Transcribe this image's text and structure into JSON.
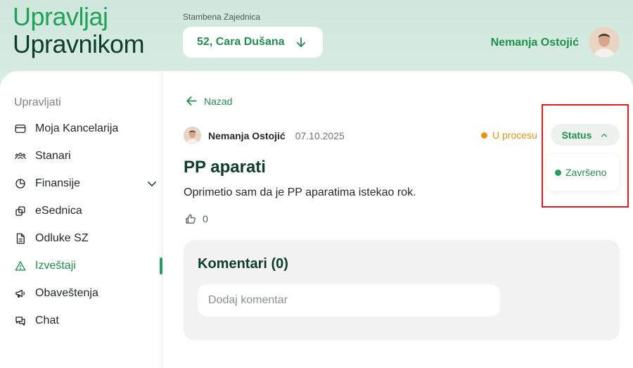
{
  "app": {
    "logo_line1": "Upravljaj",
    "logo_line2": "Upravnikom"
  },
  "header": {
    "community_label": "Stambena Zajednica",
    "building": "52, Cara Dušana",
    "user_name": "Nemanja Ostojić"
  },
  "sidebar": {
    "title": "Upravljati",
    "items": [
      {
        "label": "Moja Kancelarija",
        "icon": "wallet-icon"
      },
      {
        "label": "Stanari",
        "icon": "users-icon"
      },
      {
        "label": "Finansije",
        "icon": "pie-chart-icon"
      },
      {
        "label": "eSednica",
        "icon": "copy-icon"
      },
      {
        "label": "Odluke SZ",
        "icon": "document-icon"
      },
      {
        "label": "Izveštaji",
        "icon": "warning-icon"
      },
      {
        "label": "Obaveštenja",
        "icon": "megaphone-icon"
      },
      {
        "label": "Chat",
        "icon": "chat-icon"
      }
    ],
    "active": "Izveštaji"
  },
  "report": {
    "back_label": "Nazad",
    "author": "Nemanja Ostojić",
    "date": "07.10.2025",
    "current_status": "U procesu",
    "status_button": "Status",
    "status_options": [
      "Završeno"
    ],
    "title": "PP aparati",
    "description": "Oprimetio sam da je PP aparatima istekao rok.",
    "likes": "0"
  },
  "comments": {
    "title": "Komentari (0)",
    "placeholder": "Dodaj komentar",
    "value": ""
  },
  "colors": {
    "accent": "#22a05a",
    "dark_green": "#0f3d2b",
    "in_progress": "#e89211",
    "done": "#1fa35b",
    "highlight": "#e01d1d"
  }
}
